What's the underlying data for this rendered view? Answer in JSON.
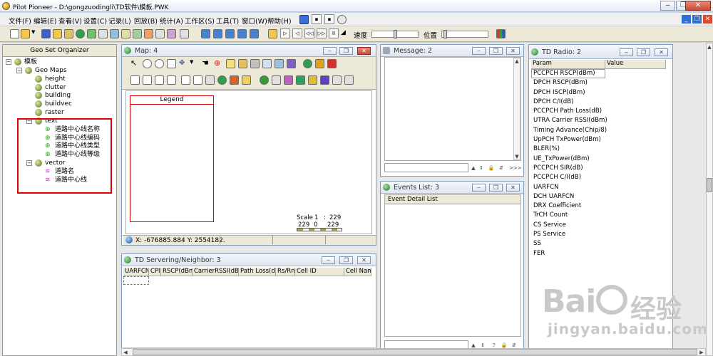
{
  "app": {
    "title": "Pilot Pioneer - D:\\gongzuodingli\\TD软件\\模板.PWK",
    "min": "‒",
    "restore": "❐",
    "close": "✕"
  },
  "menu": {
    "items": [
      "文件(F)",
      "编辑(E)",
      "查看(V)",
      "设置(C)",
      "记录(L)",
      "回放(B)",
      "统计(A)",
      "工作区(S)",
      "工具(T)",
      "窗口(W)",
      "帮助(H)"
    ]
  },
  "toolbar": {
    "speed_label": "速度",
    "position_label": "位置"
  },
  "geo": {
    "title": "Geo Set Organizer",
    "root": "模板",
    "geo_maps": "Geo Maps",
    "layers": [
      "height",
      "clutter",
      "building",
      "buildvec",
      "raster"
    ],
    "text_folder": "text",
    "text_items": [
      "道路中心线名称",
      "道路中心线编码",
      "道路中心线类型",
      "道路中心线等级"
    ],
    "vector_folder": "vector",
    "vector_items": [
      "道路名",
      "道路中心线"
    ]
  },
  "map": {
    "title": "Map: 4",
    "legend": "Legend",
    "scale_label": "Scale",
    "scale_1": "1",
    "scale_sep": ":",
    "scale_2": "229",
    "scale_a": "229",
    "scale_b": "0",
    "scale_c": "229",
    "coords": "X: -676885.884 Y: 2554182."
  },
  "message": {
    "title": "Message: 2"
  },
  "events": {
    "title": "Events List: 3",
    "header": "Event Detail List"
  },
  "servering": {
    "title": "TD Servering/Neighbor: 3",
    "columns": [
      "UARFCN",
      "CPI",
      "RSCP(dBm)",
      "CarrierRSSI(dBm)",
      "Path Loss(dB)",
      "Rs/Rn",
      "Cell ID",
      "Cell Name"
    ]
  },
  "radio": {
    "title": "TD Radio: 2",
    "col_param": "Param",
    "col_value": "Value",
    "params": [
      "PCCPCH RSCP(dBm)",
      "DPCH RSCP(dBm)",
      "DPCH ISCP(dBm)",
      "DPCH C/I(dB)",
      "PCCPCH Path Loss(dB)",
      "UTRA Carrier RSSI(dBm)",
      "Timing Advance(Chip/8)",
      "UpPCH TxPower(dBm)",
      "BLER(%)",
      "UE_TxPower(dBm)",
      "PCCPCH SIR(dB)",
      "PCCPCH C/I(dB)",
      "UARFCN",
      "DCH UARFCN",
      "DRX Coefficient",
      "TrCH Count",
      "CS Service",
      "PS Service",
      "SS",
      "FER"
    ]
  },
  "watermark": {
    "brand": "Bai",
    "brand2": "经验",
    "url": "jingyan.baidu.com"
  }
}
